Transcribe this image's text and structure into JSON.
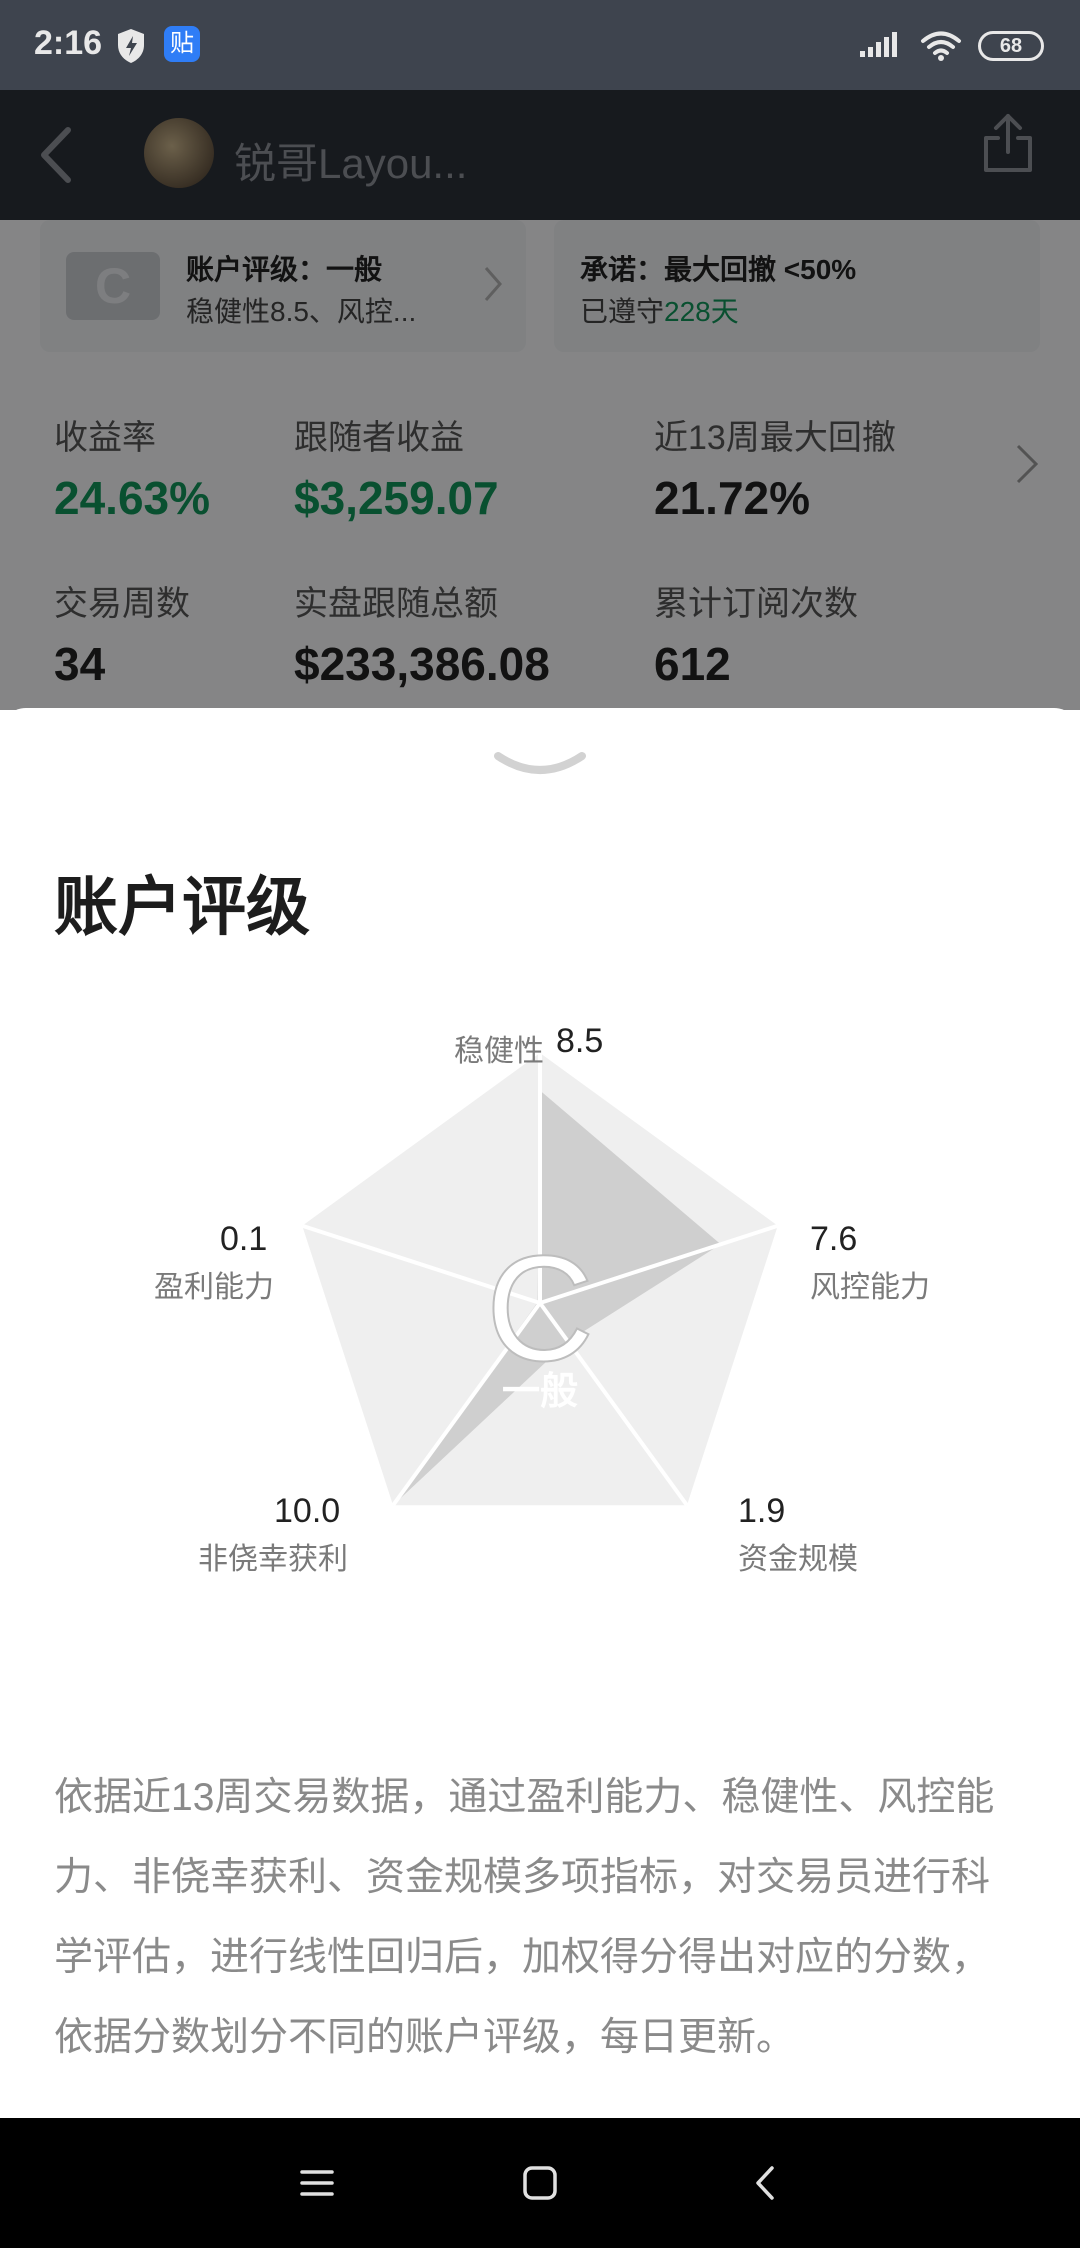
{
  "status_bar": {
    "time": "2:16",
    "app_badge": "贴",
    "battery": "68"
  },
  "header": {
    "title": "锐哥Layou..."
  },
  "rating_card": {
    "grade": "C",
    "title": "账户评级：一般",
    "subtitle": "稳健性8.5、风控..."
  },
  "promise_card": {
    "title": "承诺：最大回撤 <50%",
    "sub_prefix": "已遵守",
    "days": "228天"
  },
  "stats": [
    {
      "label": "收益率",
      "value": "24.63%"
    },
    {
      "label": "跟随者收益",
      "value": "$3,259.07"
    },
    {
      "label": "近13周最大回撤",
      "value": "21.72%"
    },
    {
      "label": "交易周数",
      "value": "34"
    },
    {
      "label": "实盘跟随总额",
      "value": "$233,386.08"
    },
    {
      "label": "累计订阅次数",
      "value": "612"
    }
  ],
  "sheet": {
    "title": "账户评级",
    "grade_letter": "C",
    "grade_word": "一般",
    "description": "依据近13周交易数据，通过盈利能力、稳健性、风控能力、非侥幸获利、资金规模多项指标，对交易员进行科学评估，进行线性回归后，加权得分得出对应的分数，依据分数划分不同的账户评级，每日更新。"
  },
  "chart_data": {
    "type": "radar",
    "axes": [
      {
        "label": "稳健性",
        "value": 8.5
      },
      {
        "label": "风控能力",
        "value": 7.6
      },
      {
        "label": "资金规模",
        "value": 1.9
      },
      {
        "label": "非侥幸获利",
        "value": 10.0
      },
      {
        "label": "盈利能力",
        "value": 0.1
      }
    ],
    "value_labels": [
      "8.5",
      "7.6",
      "1.9",
      "10.0",
      "0.1"
    ],
    "range": [
      0,
      10
    ]
  },
  "colors": {
    "accent_green": "#12945a",
    "radar_fill": "#cfcfcf",
    "radar_bg": "#efefef"
  }
}
